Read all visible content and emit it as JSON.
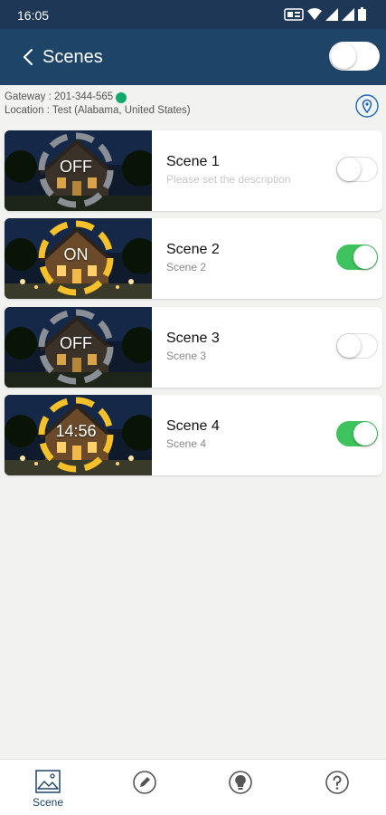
{
  "status_bar": {
    "time": "16:05",
    "icons": [
      "nfc-icon",
      "wifi-icon",
      "signal-icon",
      "signal-icon",
      "battery-icon"
    ]
  },
  "header": {
    "title": "Scenes",
    "back_icon": "chevron-left-icon",
    "master_toggle_on": false
  },
  "gateway": {
    "text": "Gateway : 201-344-565",
    "status_color": "#11a86a",
    "location": "Location : Test (Alabama, United States)",
    "location_icon": "map-pin-icon"
  },
  "scenes": [
    {
      "name": "Scene 1",
      "description": "Please set the description",
      "badge": "OFF",
      "enabled": false,
      "ring_color": "#8a8f96"
    },
    {
      "name": "Scene 2",
      "description": "Scene 2",
      "badge": "ON",
      "enabled": true,
      "ring_color": "#f5c02a"
    },
    {
      "name": "Scene 3",
      "description": "Scene 3",
      "badge": "OFF",
      "enabled": false,
      "ring_color": "#8a8f96"
    },
    {
      "name": "Scene 4",
      "description": "Scene 4",
      "badge": "14:56",
      "enabled": true,
      "ring_color": "#f5c02a"
    }
  ],
  "tabs": [
    {
      "label": "Scene",
      "icon": "image-icon",
      "active": true
    },
    {
      "label": "",
      "icon": "pencil-icon",
      "active": false
    },
    {
      "label": "",
      "icon": "bulb-icon",
      "active": false
    },
    {
      "label": "",
      "icon": "help-icon",
      "active": false
    }
  ],
  "colors": {
    "header": "#1e4468",
    "status_bar": "#1e3756",
    "toggle_on": "#3fc35e",
    "accent": "#1e4468"
  }
}
